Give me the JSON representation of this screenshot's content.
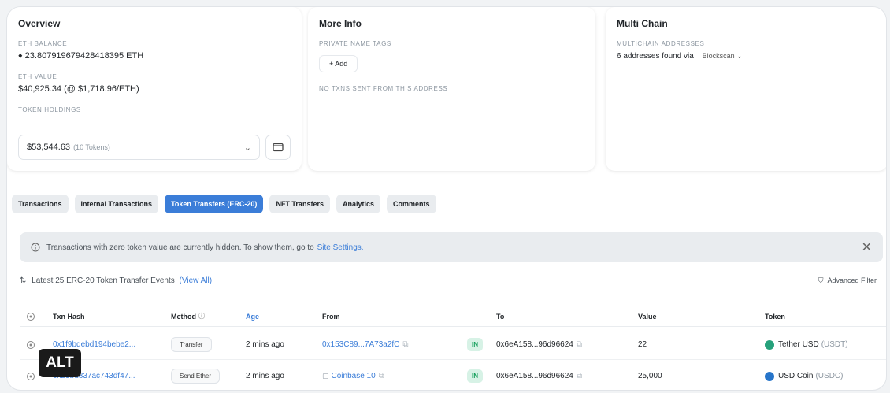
{
  "overview": {
    "title": "Overview",
    "eth_balance_label": "ETH BALANCE",
    "eth_balance_value": "♦ 23.807919679428418395 ETH",
    "eth_value_label": "ETH VALUE",
    "eth_value_value": "$40,925.34 (@ $1,718.96/ETH)",
    "token_holdings_label": "TOKEN HOLDINGS",
    "token_holdings_amount": "$53,544.63",
    "token_holdings_count": "(10 Tokens)"
  },
  "more_info": {
    "title": "More Info",
    "private_tags_label": "PRIVATE NAME TAGS",
    "add_label": "+ Add",
    "no_txns_text": "NO TXNS SENT FROM THIS ADDRESS"
  },
  "multi_chain": {
    "title": "Multi Chain",
    "addresses_label": "MULTICHAIN ADDRESSES",
    "addresses_text": "6 addresses found via",
    "select_label": "Blockscan ⌄"
  },
  "tabs": [
    {
      "label": "Transactions",
      "active": false
    },
    {
      "label": "Internal Transactions",
      "active": false
    },
    {
      "label": "Token Transfers (ERC-20)",
      "active": true
    },
    {
      "label": "NFT Transfers",
      "active": false
    },
    {
      "label": "Analytics",
      "active": false
    },
    {
      "label": "Comments",
      "active": false
    }
  ],
  "alert": {
    "text": "Transactions with zero token value are currently hidden. To show them, go to",
    "link": "Site Settings."
  },
  "latest": {
    "text": "Latest 25 ERC-20 Token Transfer Events",
    "link": "(View All)"
  },
  "advanced_filter": "Advanced Filter",
  "table": {
    "headers": [
      "Txn Hash",
      "Method",
      "Age",
      "From",
      "To",
      "Value",
      "Token"
    ],
    "rows": [
      {
        "hash": "0x1f9bdebd194bebe2...",
        "method": "Transfer",
        "age": "2 mins ago",
        "from": "0x153C89...7A73a2fC",
        "direction": "IN",
        "to": "0x6eA158...96d96624",
        "value": "22",
        "token_name": "Tether USD",
        "token_symbol": "(USDT)",
        "token_color": "#26a17b"
      },
      {
        "hash": "0x25bd837ac743df47...",
        "method": "Send Ether",
        "age": "2 mins ago",
        "from": "Coinbase 10",
        "direction": "IN",
        "to": "0x6eA158...96d96624",
        "value": "25,000",
        "token_name": "USD Coin",
        "token_symbol": "(USDC)",
        "token_color": "#2775ca"
      }
    ]
  },
  "alt_badge": "ALT"
}
